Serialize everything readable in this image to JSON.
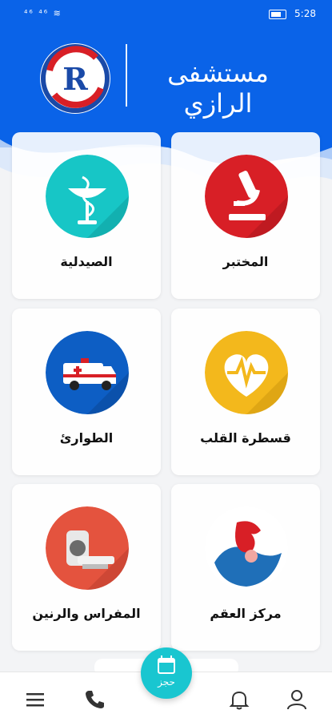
{
  "status_bar": {
    "left_icons": "⁴⁶ ⁴⁶ ≋",
    "battery_label": "battery-icon",
    "time": "5:28"
  },
  "header": {
    "hospital_name": "مستشفى الرازي",
    "logo_label": "R",
    "brand_color": "#0a63e8"
  },
  "services": [
    {
      "label": "المختبر",
      "icon": "microscope-icon",
      "color": "#d81f26"
    },
    {
      "label": "الصيدلية",
      "icon": "pharmacy-icon",
      "color": "#17c6c6"
    },
    {
      "label": "قسطرة القلب",
      "icon": "heart-icon",
      "color": "#f3b81c"
    },
    {
      "label": "الطوارئ",
      "icon": "ambulance-icon",
      "color": "#0d5ec4"
    },
    {
      "label": "مركز العقم",
      "icon": "fertility-icon",
      "color": "#1f6fb8"
    },
    {
      "label": "المفراس والرنين",
      "icon": "scanner-icon",
      "color": "#e4533e"
    }
  ],
  "bottom_nav": {
    "book_label": "حجز",
    "items": [
      "profile-icon",
      "bell-icon",
      "phone-icon",
      "menu-icon"
    ]
  }
}
